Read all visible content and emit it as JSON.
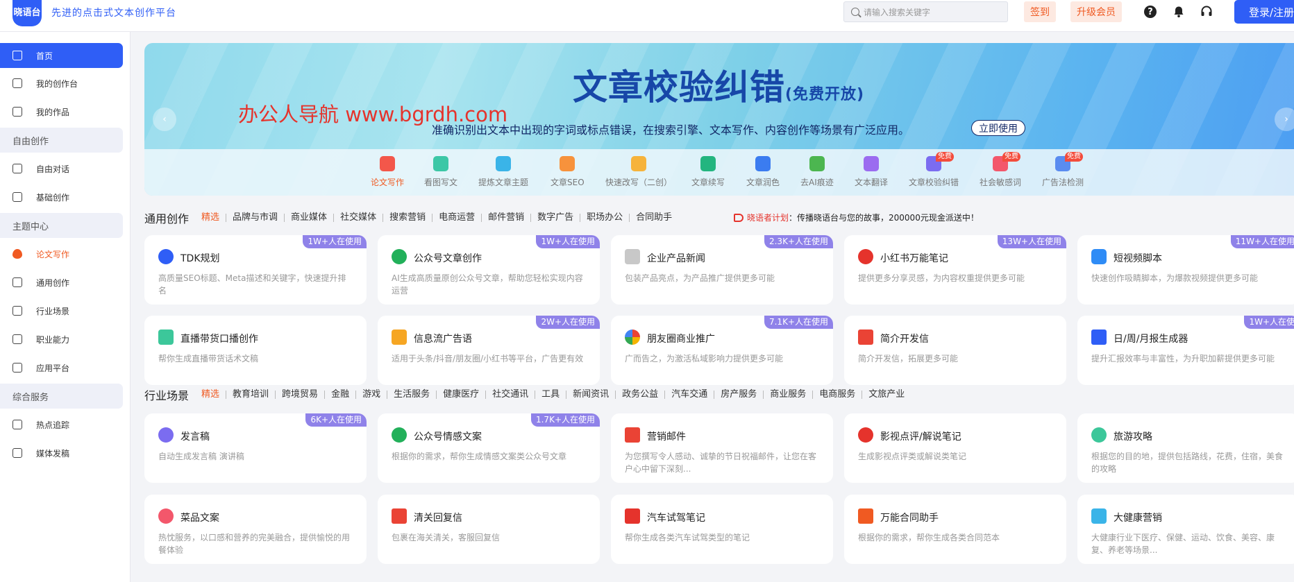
{
  "header": {
    "logo_text": "晓语台",
    "slogan": "先进的点击式文本创作平台",
    "search_placeholder": "请输入搜索关键字",
    "sign_in_label": "签到",
    "upgrade_label": "升级会员",
    "help_glyph": "?",
    "login_label": "登录/注册",
    "icons": [
      "help-icon",
      "bell-icon",
      "headset-icon"
    ]
  },
  "sidebar": {
    "items": [
      {
        "label": "首页",
        "icon": "home-icon"
      },
      {
        "label": "我的创作台",
        "icon": "workspace-icon"
      },
      {
        "label": "我的作品",
        "icon": "works-icon"
      },
      {
        "label": "自由创作",
        "group": true
      },
      {
        "label": "自由对话",
        "icon": "chat-icon"
      },
      {
        "label": "基础创作",
        "icon": "edit-icon"
      },
      {
        "label": "主题中心",
        "group": true
      },
      {
        "label": "论文写作",
        "icon": "fire-icon"
      },
      {
        "label": "通用创作",
        "icon": "layers-icon"
      },
      {
        "label": "行业场景",
        "icon": "list-icon"
      },
      {
        "label": "职业能力",
        "icon": "id-card-icon"
      },
      {
        "label": "应用平台",
        "icon": "app-icon"
      },
      {
        "label": "综合服务",
        "group": true
      },
      {
        "label": "热点追踪",
        "icon": "trend-icon"
      },
      {
        "label": "媒体发稿",
        "icon": "document-icon"
      }
    ]
  },
  "banner": {
    "title": "文章校验纠错",
    "title_sub": "(免费开放)",
    "description": "准确识别出文本中出现的字词或标点错误，在搜索引擎、文本写作、内容创作等场景有广泛应用。",
    "cta_label": "立即使用",
    "watermark": "办公人导航 www.bgrdh.com",
    "prev_glyph": "‹",
    "next_glyph": "›",
    "free_badge": "免费",
    "tools": [
      {
        "label": "论文写作",
        "color": "#f3574a",
        "active": true
      },
      {
        "label": "看图写文",
        "color": "#3cc7a6"
      },
      {
        "label": "提炼文章主题",
        "color": "#3ab4e8"
      },
      {
        "label": "文章SEO",
        "color": "#f7923c"
      },
      {
        "label": "快速改写（二创）",
        "color": "#f6b33b"
      },
      {
        "label": "文章续写",
        "color": "#23b57f"
      },
      {
        "label": "文章润色",
        "color": "#3b7cf0"
      },
      {
        "label": "去AI痕迹",
        "color": "#4cb650"
      },
      {
        "label": "文本翻译",
        "color": "#9b6cf0"
      },
      {
        "label": "文章校验纠错",
        "color": "#7b6cf0",
        "free": true
      },
      {
        "label": "社会敏感词",
        "color": "#f3576b",
        "free": true
      },
      {
        "label": "广告法检测",
        "color": "#5a8cf0",
        "free": true
      }
    ]
  },
  "general_section": {
    "title": "通用创作",
    "categories": [
      "精选",
      "品牌与市调",
      "商业媒体",
      "社交媒体",
      "搜索营销",
      "电商运营",
      "邮件营销",
      "数字广告",
      "职场办公",
      "合同助手"
    ],
    "promo_prefix": "晓语者计划",
    "promo_text": "：传播晓语台与您的故事，200000元现金派送中！",
    "cards": [
      {
        "title": "TDK规划",
        "desc": "高质量SEO标题、Meta描述和关键字，快速提升排名",
        "usage": "1W+人在使用",
        "icon_color": "#2f5ef6"
      },
      {
        "title": "公众号文章创作",
        "desc": "AI生成高质量原创公众号文章，帮助您轻松实现内容运营",
        "usage": "1W+人在使用",
        "icon_color": "#22b05a"
      },
      {
        "title": "企业产品新闻",
        "desc": "包装产品亮点，为产品推广提供更多可能",
        "usage": "2.3K+人在使用",
        "icon_color": "#c8c8c8"
      },
      {
        "title": "小红书万能笔记",
        "desc": "提供更多分享灵感，为内容权重提供更多可能",
        "usage": "13W+人在使用",
        "icon_color": "#e5332c"
      },
      {
        "title": "短视频脚本",
        "desc": "快速创作吸睛脚本，为爆款视频提供更多可能",
        "usage": "11W+人在使用",
        "icon_color": "#2f8cf6"
      },
      {
        "title": "直播带货口播创作",
        "desc": "帮你生成直播带货话术文稿",
        "usage": "",
        "icon_color": "#3cc79a"
      },
      {
        "title": "信息流广告语",
        "desc": "适用于头条/抖音/朋友圈/小红书等平台，广告更有效",
        "usage": "2W+人在使用",
        "icon_color": "#f6a623"
      },
      {
        "title": "朋友圈商业推广",
        "desc": "广而告之，为激活私域影响力提供更多可能",
        "usage": "7.1K+人在使用",
        "icon_color": "#f4b400"
      },
      {
        "title": "简介开发信",
        "desc": "简介开发信，拓展更多可能",
        "usage": "",
        "icon_color": "#ea4335"
      },
      {
        "title": "日/周/月报生成器",
        "desc": "提升汇报效率与丰富性，为升职加薪提供更多可能",
        "usage": "1W+人在使",
        "icon_color": "#2f5ef6"
      }
    ]
  },
  "industry_section": {
    "title": "行业场景",
    "categories": [
      "精选",
      "教育培训",
      "跨境贸易",
      "金融",
      "游戏",
      "生活服务",
      "健康医疗",
      "社交通讯",
      "工具",
      "新闻资讯",
      "政务公益",
      "汽车交通",
      "房产服务",
      "商业服务",
      "电商服务",
      "文旅产业"
    ],
    "cards": [
      {
        "title": "发言稿",
        "desc": "自动生成发言稿 演讲稿",
        "usage": "6K+人在使用",
        "icon_color": "#7b6cf0"
      },
      {
        "title": "公众号情感文案",
        "desc": "根据你的需求，帮你生成情感文案类公众号文章",
        "usage": "1.7K+人在使用",
        "icon_color": "#22b05a"
      },
      {
        "title": "营销邮件",
        "desc": "为您撰写令人感动、诚挚的节日祝福邮件，让您在客户心中留下深刻...",
        "usage": "",
        "icon_color": "#ea4335"
      },
      {
        "title": "影视点评/解说笔记",
        "desc": "生成影视点评类或解说类笔记",
        "usage": "",
        "icon_color": "#e5332c"
      },
      {
        "title": "旅游攻略",
        "desc": "根据您的目的地，提供包括路线，花费，住宿，美食的攻略",
        "usage": "",
        "icon_color": "#3cc79a"
      },
      {
        "title": "菜品文案",
        "desc": "热忱服务，以口感和营养的完美融合，提供愉悦的用餐体验",
        "usage": "",
        "icon_color": "#f3576b"
      },
      {
        "title": "清关回复信",
        "desc": "包裹在海关清关，客服回复信",
        "usage": "",
        "icon_color": "#ea4335"
      },
      {
        "title": "汽车试驾笔记",
        "desc": "帮你生成各类汽车试驾类型的笔记",
        "usage": "",
        "icon_color": "#e5332c"
      },
      {
        "title": "万能合同助手",
        "desc": "根据你的需求，帮你生成各类合同范本",
        "usage": "",
        "icon_color": "#f05a22"
      },
      {
        "title": "大健康营销",
        "desc": "大健康行业下医疗、保健、运动、饮食、美容、康复、养老等场景...",
        "usage": "",
        "icon_color": "#3ab4e8"
      }
    ]
  },
  "colors": {
    "accent": "#2f5ef6",
    "hot": "#f05a22",
    "usage_badge": "#8f82e9"
  }
}
